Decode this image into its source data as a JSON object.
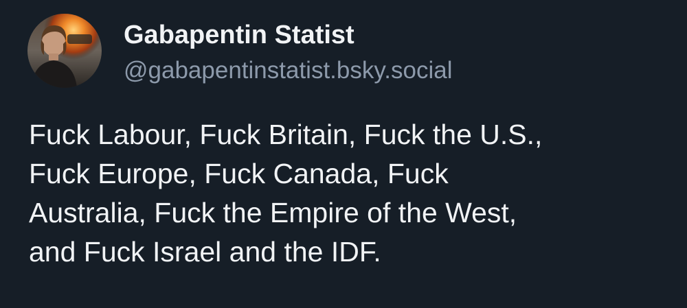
{
  "post": {
    "author": {
      "display_name": "Gabapentin Statist",
      "handle": "@gabapentinstatist.bsky.social",
      "avatar_icon": "user-avatar"
    },
    "text": "Fuck Labour, Fuck Britain, Fuck the U.S.,\nFuck Europe, Fuck Canada, Fuck\nAustralia, Fuck the Empire of the West,\nand Fuck Israel and the IDF."
  },
  "colors": {
    "background": "#161e27",
    "text": "#f1f3f5",
    "handle": "#8d9aab"
  }
}
